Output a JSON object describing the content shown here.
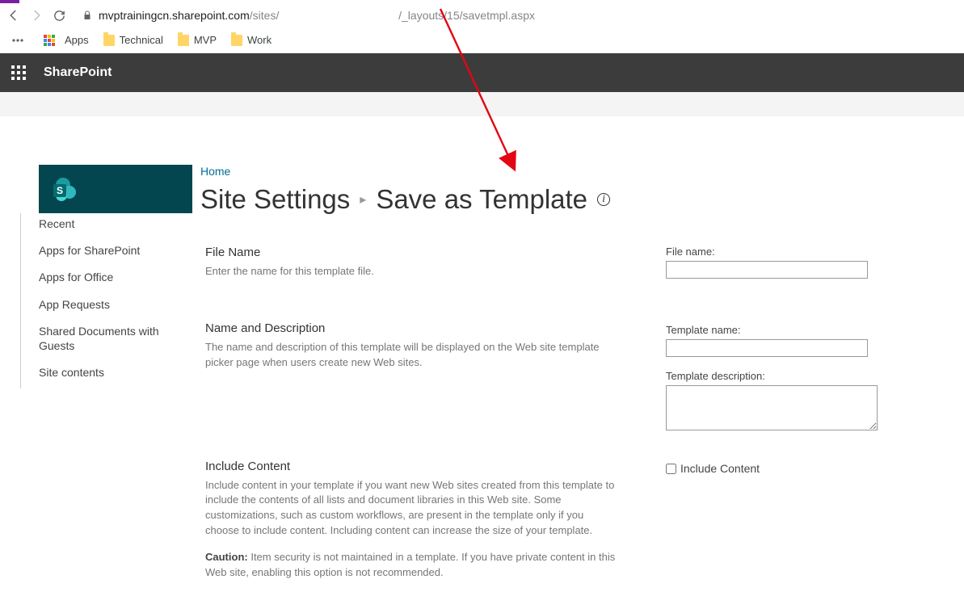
{
  "browser": {
    "url_host": "mvptrainingcn.sharepoint.com",
    "url_path1": "/sites/",
    "url_path2": "/_layouts/15/savetmpl.aspx",
    "bookmarks": {
      "apps": "Apps",
      "b1": "Technical",
      "b2": "MVP",
      "b3": "Work"
    }
  },
  "suite": {
    "name": "SharePoint"
  },
  "header": {
    "home": "Home",
    "t1": "Site Settings",
    "t2": "Save as Template"
  },
  "leftnav": {
    "i0": "Recent",
    "i1": "Apps for SharePoint",
    "i2": "Apps for Office",
    "i3": "App Requests",
    "i4": "Shared Documents with Guests",
    "i5": "Site contents"
  },
  "sections": {
    "fileName": {
      "h": "File Name",
      "p": "Enter the name for this template file."
    },
    "nameDesc": {
      "h": "Name and Description",
      "p": "The name and description of this template will be displayed on the Web site template picker page when users create new Web sites."
    },
    "include": {
      "h": "Include Content",
      "p1": "Include content in your template if you want new Web sites created from this template to include the contents of all lists and document libraries in this Web site. Some customizations, such as custom workflows, are present in the template only if you choose to include content. Including content can increase the size of your template.",
      "cautionLabel": "Caution:",
      "caution": " Item security is not maintained in a template. If you have private content in this Web site, enabling this option is not recommended."
    }
  },
  "form": {
    "fileNameLabel": "File name:",
    "tplNameLabel": "Template name:",
    "tplDescLabel": "Template description:",
    "includeLabel": "Include Content"
  }
}
